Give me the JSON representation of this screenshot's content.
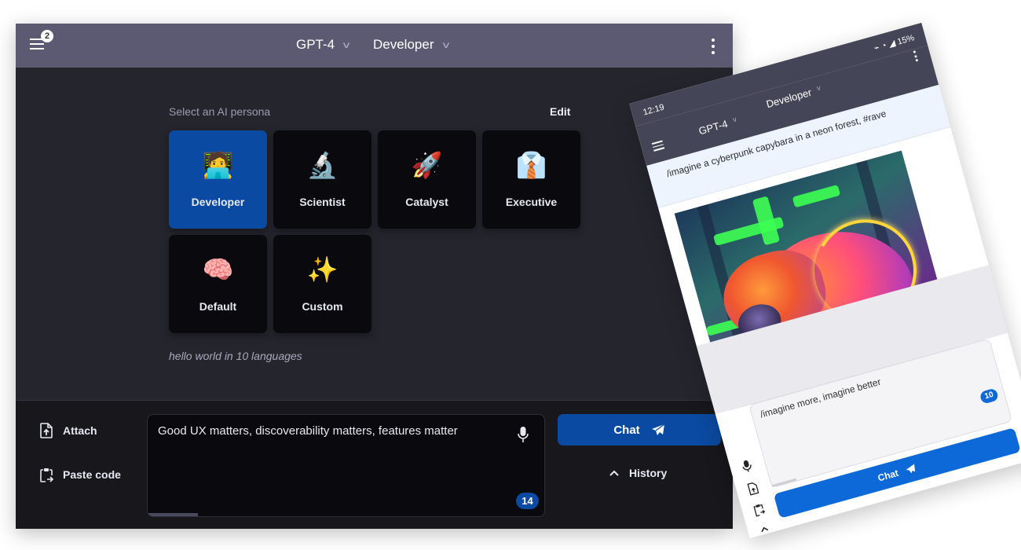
{
  "desktop": {
    "header": {
      "menu_badge": "2",
      "model_label": "GPT-4",
      "persona_label": "Developer"
    },
    "persona_section": {
      "title": "Select an AI persona",
      "edit_label": "Edit",
      "personas": [
        {
          "label": "Developer",
          "emoji": "🧑‍💻",
          "active": true
        },
        {
          "label": "Scientist",
          "emoji": "🔬",
          "active": false
        },
        {
          "label": "Catalyst",
          "emoji": "🚀",
          "active": false
        },
        {
          "label": "Executive",
          "emoji": "👔",
          "active": false
        },
        {
          "label": "Default",
          "emoji": "🧠",
          "active": false
        },
        {
          "label": "Custom",
          "emoji": "✨",
          "active": false
        }
      ],
      "example_prompt": "hello world in 10 languages"
    },
    "composer": {
      "attach_label": "Attach",
      "paste_code_label": "Paste code",
      "input_value": "Good UX matters, discoverability matters, features matter",
      "token_count": "14",
      "chat_label": "Chat",
      "history_label": "History"
    },
    "colors": {
      "header_bg": "#5b5a72",
      "body_bg": "#25252e",
      "accent": "#0b4aa2"
    }
  },
  "mobile": {
    "status_bar": {
      "time": "12:19",
      "battery": "15%"
    },
    "header": {
      "model_label": "GPT-4",
      "persona_label": "Developer"
    },
    "user_message": "/imagine a cyberpunk capybara in a neon forest, #rave",
    "image_alt": "cyberpunk capybara in a neon forest",
    "composer": {
      "input_value": "/imagine more, imagine better",
      "token_count": "10",
      "chat_label": "Chat"
    },
    "colors": {
      "header_bg": "#454558",
      "accent": "#0e69d8"
    }
  }
}
